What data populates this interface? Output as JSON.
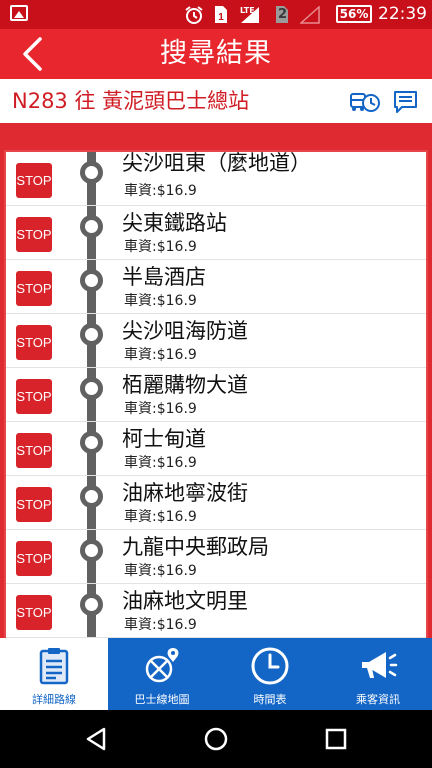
{
  "status_bar": {
    "lte_label": "LTE",
    "sim_label": "2",
    "battery_percent": "56%",
    "time": "22:39"
  },
  "app_bar": {
    "title": "搜尋結果",
    "back_icon": "chevron-left-icon"
  },
  "route": {
    "title": "N283 往 黃泥頭巴士總站",
    "schedule_icon": "bus-clock-icon",
    "notice_icon": "message-icon"
  },
  "stops": [
    {
      "badge": "STOP",
      "name": "尖沙咀東（麼地道）",
      "fare": "車資:$16.9"
    },
    {
      "badge": "STOP",
      "name": "尖東鐵路站",
      "fare": "車資:$16.9"
    },
    {
      "badge": "STOP",
      "name": "半島酒店",
      "fare": "車資:$16.9"
    },
    {
      "badge": "STOP",
      "name": "尖沙咀海防道",
      "fare": "車資:$16.9"
    },
    {
      "badge": "STOP",
      "name": "栢麗購物大道",
      "fare": "車資:$16.9"
    },
    {
      "badge": "STOP",
      "name": "柯士甸道",
      "fare": "車資:$16.9"
    },
    {
      "badge": "STOP",
      "name": "油麻地寧波街",
      "fare": "車資:$16.9"
    },
    {
      "badge": "STOP",
      "name": "九龍中央郵政局",
      "fare": "車資:$16.9"
    },
    {
      "badge": "STOP",
      "name": "油麻地文明里",
      "fare": "車資:$16.9"
    }
  ],
  "tabs": [
    {
      "label": "詳細路線",
      "icon": "clipboard-icon",
      "active": true
    },
    {
      "label": "巴士線地圖",
      "icon": "map-pin-icon",
      "active": false
    },
    {
      "label": "時間表",
      "icon": "clock-icon",
      "active": false
    },
    {
      "label": "乘客資訊",
      "icon": "megaphone-icon",
      "active": false
    }
  ],
  "colors": {
    "brand_red": "#e8262d",
    "status_red": "#c8101b",
    "tab_blue": "#1466c6",
    "route_line_grey": "#616161"
  }
}
